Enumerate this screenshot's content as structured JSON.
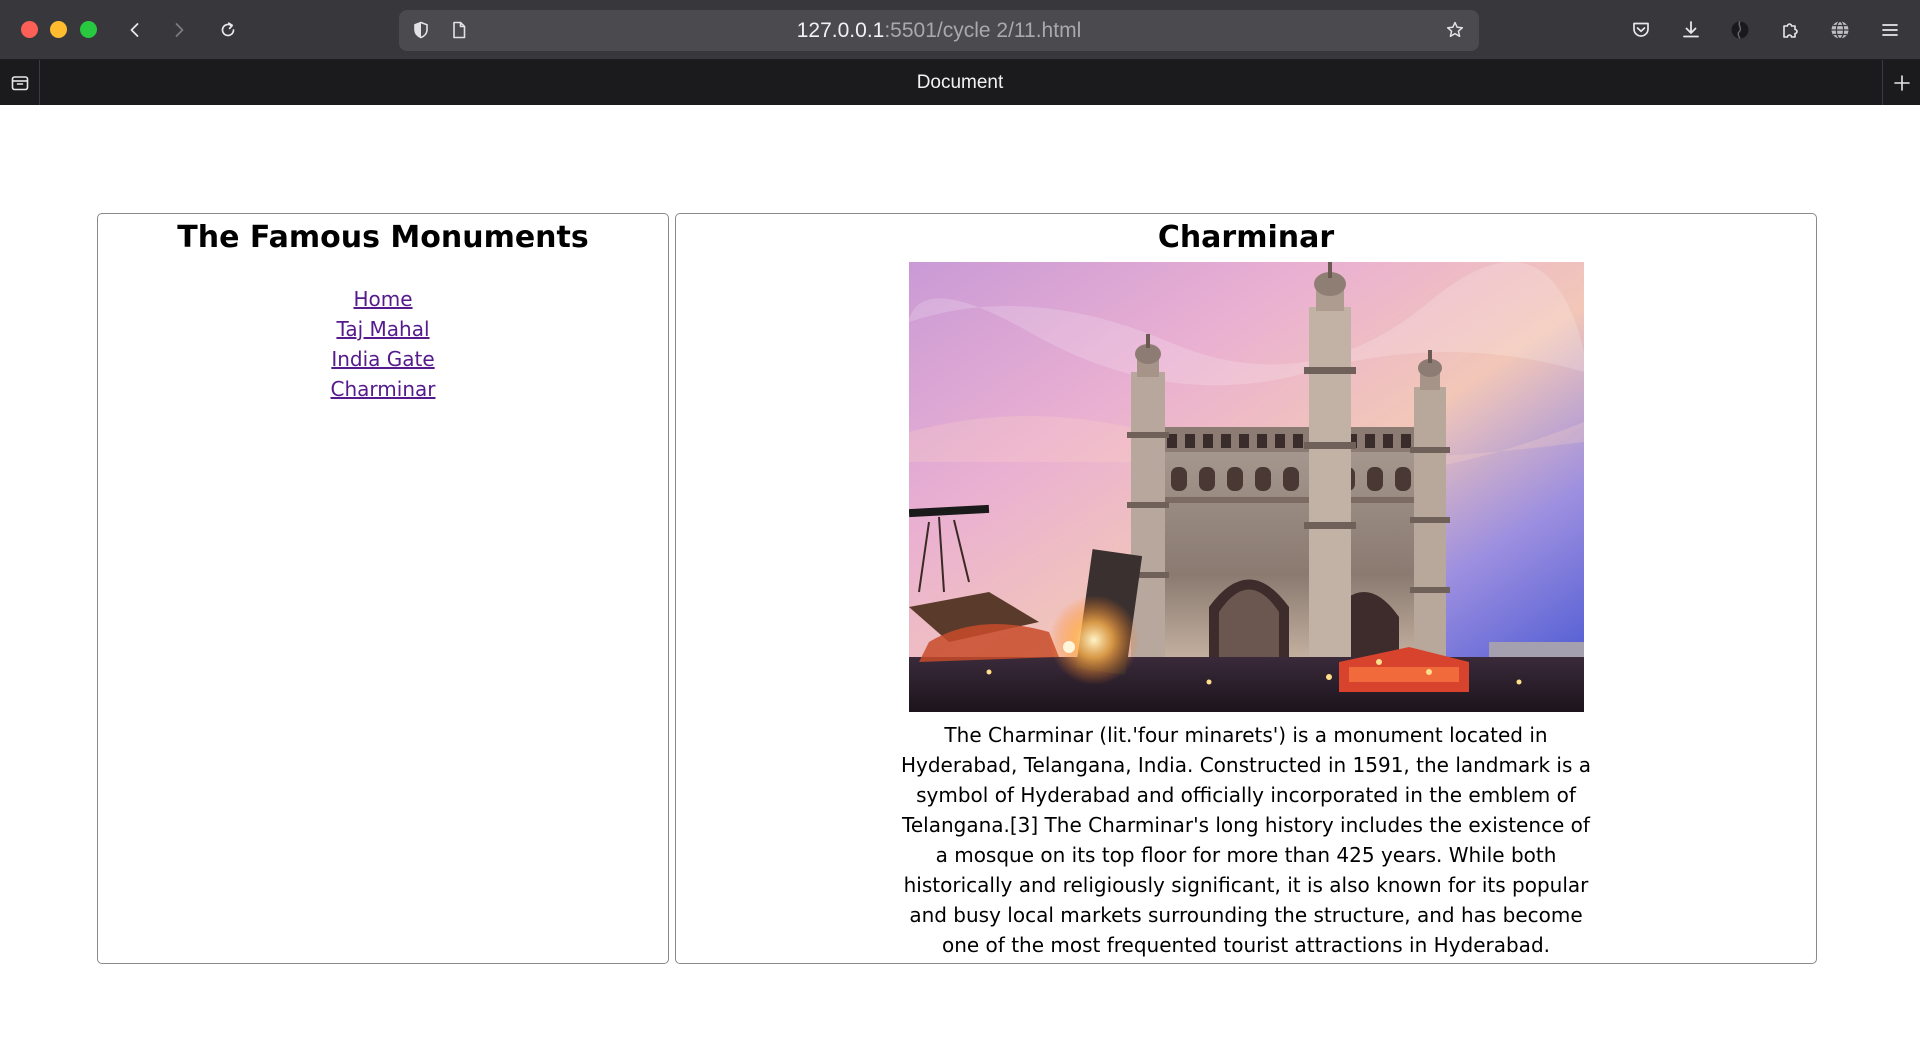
{
  "browser": {
    "url_host": "127.0.0.1",
    "url_path": ":5501/cycle 2/11.html",
    "tab_title": "Document",
    "icons": {
      "back": "chevron-left-icon",
      "forward": "chevron-right-icon",
      "reload": "reload-icon",
      "tracking_protection": "shield-icon",
      "page_info": "page-icon",
      "bookmark": "star-icon",
      "pocket": "pocket-icon",
      "downloads": "download-icon",
      "account": "account-icon",
      "extensions": "puzzle-icon",
      "globe": "globe-icon",
      "menu": "hamburger-menu-icon",
      "tab_overview": "tab-overview-icon",
      "new_tab": "plus-icon"
    }
  },
  "sidebar": {
    "heading": "The Famous Monuments",
    "links": [
      {
        "label": "Home"
      },
      {
        "label": "Taj Mahal"
      },
      {
        "label": "India Gate"
      },
      {
        "label": "Charminar"
      }
    ]
  },
  "main": {
    "heading": "Charminar",
    "image_icon": "charminar-photo",
    "description": "The Charminar (lit.'four minarets') is a monument located in Hyderabad, Telangana, India. Constructed in 1591, the landmark is a symbol of Hyderabad and officially incorporated in the emblem of Telangana.[3] The Charminar's long history includes the existence of a mosque on its top floor for more than 425 years. While both historically and religiously significant, it is also known for its popular and busy local markets surrounding the structure, and has become one of the most frequented tourist attractions in Hyderabad."
  },
  "colors": {
    "link": "#551a8b",
    "chrome_bg": "#38383c",
    "tabbar_bg": "#1b1b1d",
    "panel_border": "#8a8a8a"
  }
}
